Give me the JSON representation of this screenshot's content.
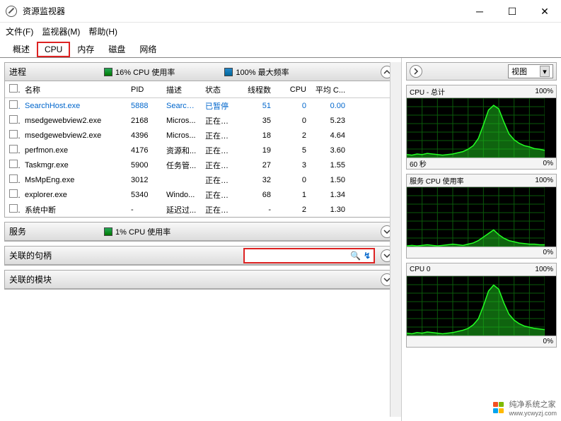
{
  "window": {
    "title": "资源监视器"
  },
  "menu": {
    "file": "文件(F)",
    "monitor": "监视器(M)",
    "help": "帮助(H)"
  },
  "tabs": {
    "overview": "概述",
    "cpu": "CPU",
    "memory": "内存",
    "disk": "磁盘",
    "network": "网络"
  },
  "processes": {
    "title": "进程",
    "cpu_usage": "16% CPU 使用率",
    "max_freq": "100% 最大频率",
    "headers": {
      "name": "名称",
      "pid": "PID",
      "desc": "描述",
      "state": "状态",
      "threads": "线程数",
      "cpu": "CPU",
      "avg": "平均 C..."
    },
    "rows": [
      {
        "name": "SearchHost.exe",
        "pid": "5888",
        "desc": "Search...",
        "state": "已暂停",
        "threads": "51",
        "cpu": "0",
        "avg": "0.00",
        "blue": true
      },
      {
        "name": "msedgewebview2.exe",
        "pid": "2168",
        "desc": "Micros...",
        "state": "正在运行",
        "threads": "35",
        "cpu": "0",
        "avg": "5.23"
      },
      {
        "name": "msedgewebview2.exe",
        "pid": "4396",
        "desc": "Micros...",
        "state": "正在运行",
        "threads": "18",
        "cpu": "2",
        "avg": "4.64"
      },
      {
        "name": "perfmon.exe",
        "pid": "4176",
        "desc": "资源和...",
        "state": "正在运行",
        "threads": "19",
        "cpu": "5",
        "avg": "3.60"
      },
      {
        "name": "Taskmgr.exe",
        "pid": "5900",
        "desc": "任务管...",
        "state": "正在运行",
        "threads": "27",
        "cpu": "3",
        "avg": "1.55"
      },
      {
        "name": "MsMpEng.exe",
        "pid": "3012",
        "desc": "",
        "state": "正在运行",
        "threads": "32",
        "cpu": "0",
        "avg": "1.50"
      },
      {
        "name": "explorer.exe",
        "pid": "5340",
        "desc": "Windo...",
        "state": "正在运行",
        "threads": "68",
        "cpu": "1",
        "avg": "1.34"
      },
      {
        "name": "系统中断",
        "pid": "-",
        "desc": "延迟过...",
        "state": "正在运行",
        "threads": "-",
        "cpu": "2",
        "avg": "1.30"
      }
    ]
  },
  "services": {
    "title": "服务",
    "cpu_usage": "1% CPU 使用率"
  },
  "handles": {
    "title": "关联的句柄",
    "placeholder": ""
  },
  "modules": {
    "title": "关联的模块"
  },
  "right": {
    "view": "视图",
    "graphs": [
      {
        "title": "CPU - 总计",
        "right": "100%",
        "bl": "60 秒",
        "br": "0%"
      },
      {
        "title": "服务 CPU 使用率",
        "right": "100%",
        "bl": "",
        "br": "0%"
      },
      {
        "title": "CPU 0",
        "right": "100%",
        "bl": "",
        "br": "0%"
      }
    ]
  },
  "watermark": {
    "text": "纯净系统之家",
    "url": "www.ycwyzj.com"
  },
  "chart_data": [
    {
      "type": "area",
      "title": "CPU - 总计",
      "ylim": [
        0,
        100
      ],
      "xrange_seconds": 60,
      "values": [
        5,
        4,
        6,
        5,
        7,
        6,
        5,
        4,
        5,
        6,
        8,
        10,
        14,
        20,
        32,
        55,
        80,
        88,
        82,
        60,
        40,
        30,
        24,
        20,
        18,
        15,
        14,
        12
      ],
      "color": "#22cc22"
    },
    {
      "type": "area",
      "title": "服务 CPU 使用率",
      "ylim": [
        0,
        100
      ],
      "xrange_seconds": 60,
      "values": [
        1,
        2,
        1,
        2,
        3,
        2,
        1,
        2,
        3,
        4,
        3,
        2,
        4,
        6,
        10,
        16,
        22,
        28,
        20,
        14,
        10,
        8,
        6,
        5,
        4,
        4,
        3,
        3
      ],
      "color": "#22cc22"
    },
    {
      "type": "area",
      "title": "CPU 0",
      "ylim": [
        0,
        100
      ],
      "xrange_seconds": 60,
      "values": [
        4,
        3,
        5,
        4,
        6,
        5,
        4,
        3,
        4,
        5,
        7,
        9,
        12,
        18,
        28,
        50,
        75,
        85,
        78,
        55,
        36,
        26,
        20,
        16,
        14,
        12,
        11,
        10
      ],
      "color": "#22cc22"
    }
  ]
}
